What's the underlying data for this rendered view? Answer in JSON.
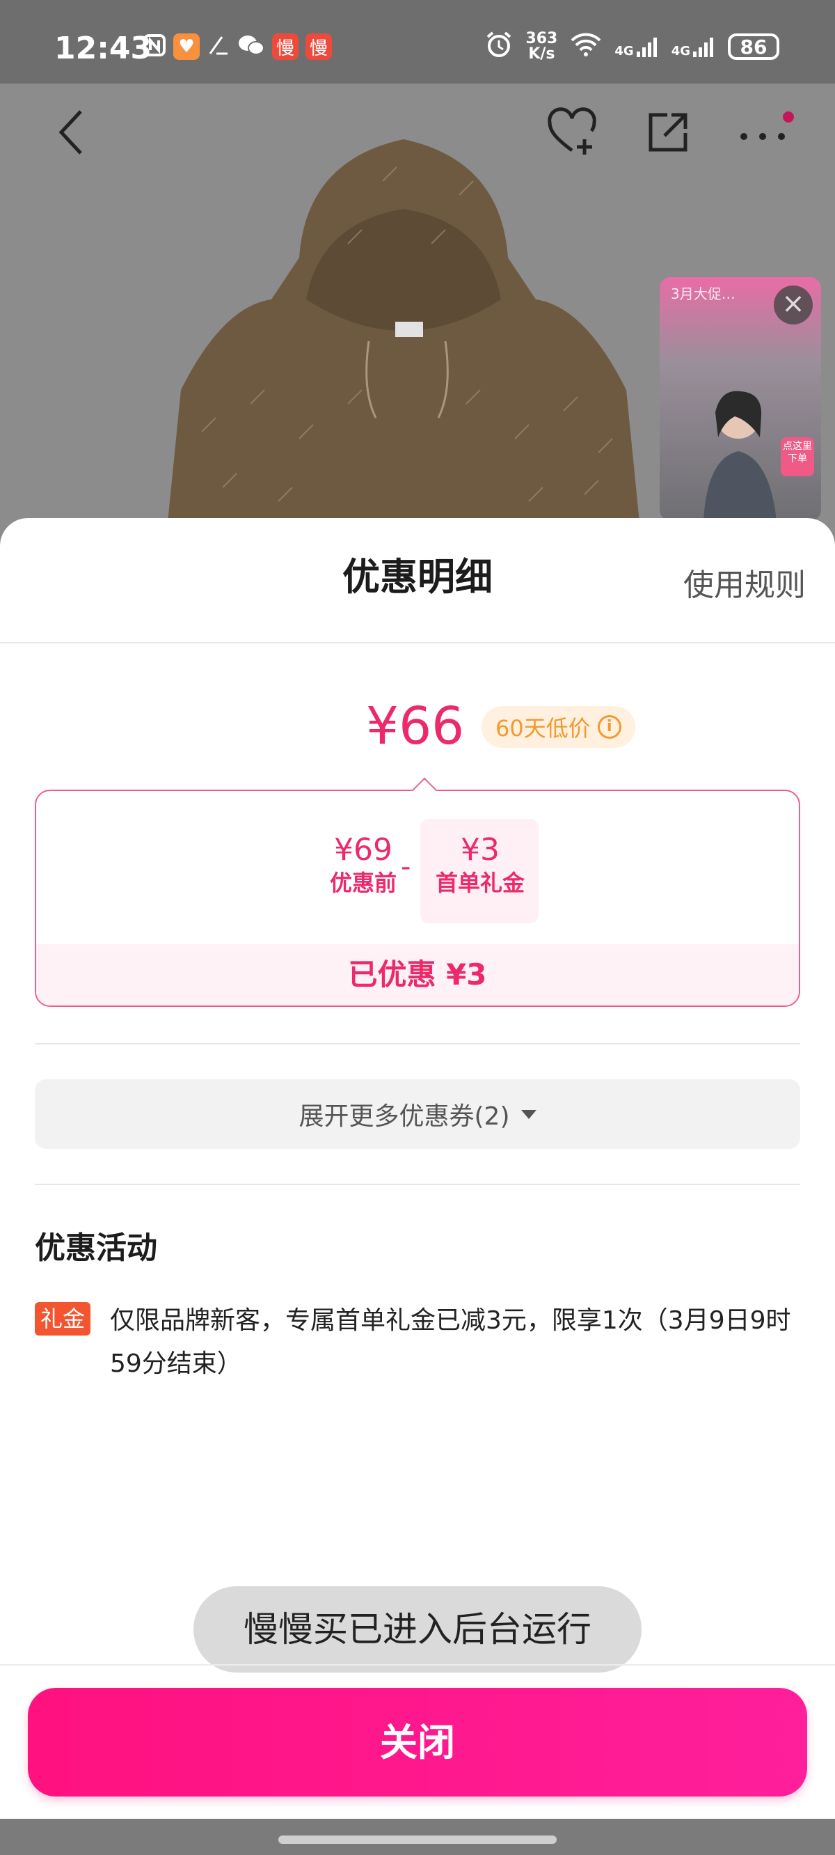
{
  "status_bar": {
    "time": "12:43",
    "app_badge_1": "慢",
    "app_badge_2": "慢",
    "net_speed_value": "363",
    "net_speed_unit": "K/s",
    "signal_1": "4G",
    "signal_2": "4G",
    "battery": "86"
  },
  "live_card": {
    "top_text": "3月大促…",
    "tag": "点这里下单"
  },
  "sheet": {
    "title": "优惠明细",
    "rules_link": "使用规则",
    "final_price": "¥66",
    "low_price_badge": "60天低价",
    "info_symbol": "i",
    "original_price": "¥69",
    "original_label": "优惠前",
    "minus": "-",
    "gift_amount": "¥3",
    "gift_label": "首单礼金",
    "saved_text": "已优惠 ¥3",
    "more_coupons": "展开更多优惠券(2)",
    "activities_title": "优惠活动",
    "activity_tag": "礼金",
    "activity_text": "仅限品牌新客，专属首单礼金已减3元，限享1次（3月9日9时59分结束）",
    "close_button": "关闭"
  },
  "toast": "慢慢买已进入后台运行",
  "colors": {
    "accent": "#ec2a6a",
    "button_start": "#ff117f",
    "button_end": "#ff1f9b",
    "badge_bg": "#fff0e0",
    "badge_text": "#f39a2b",
    "tag_bg": "#f2552f"
  }
}
